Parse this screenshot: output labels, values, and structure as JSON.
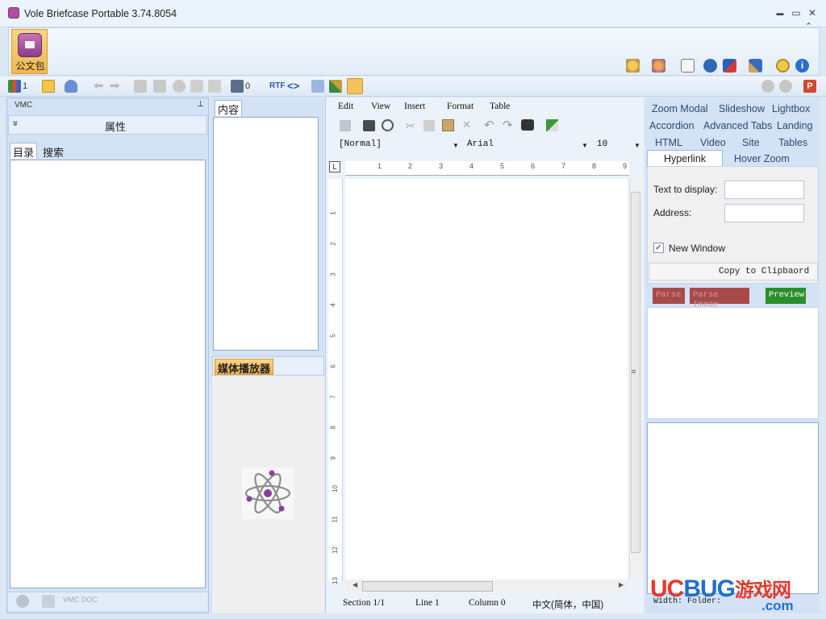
{
  "window": {
    "title": "Vole Briefcase Portable  3.74.8054",
    "minimize_glyph": "▬",
    "maximize_glyph": "▭",
    "close_glyph": "✕",
    "collapse_glyph": "⌃"
  },
  "ribbon": {
    "tile_label": "公文包",
    "icons": [
      "paint-icon",
      "magic-icon",
      "book-icon",
      "globe-icon",
      "flag-icon",
      "tools-icon",
      "medal-icon",
      "info-icon"
    ]
  },
  "toolbar": {
    "counter_1": "1",
    "counter_2": "0",
    "rtf_label": "RTF"
  },
  "left_panel": {
    "header": "VMC",
    "pin_glyph": "⊥",
    "collapse_glyph": "»",
    "properties_label": "属性",
    "tabs": [
      "目录",
      "搜索"
    ],
    "bottom_icons": [
      "VMC",
      "DOC"
    ]
  },
  "mid_panel": {
    "content_tab": "内容",
    "media_tab": "媒体播放器"
  },
  "editor": {
    "menu": [
      "Edit",
      "View",
      "Insert",
      "Format",
      "Table"
    ],
    "style_value": "[Normal]",
    "font_value": "Arial",
    "size_value": "10",
    "ruler_marks": [
      "1",
      "2",
      "3",
      "4",
      "5",
      "6",
      "7",
      "8",
      "9"
    ],
    "vruler_marks": [
      "1",
      "2",
      "3",
      "4",
      "5",
      "6",
      "7",
      "8",
      "9",
      "10",
      "11",
      "12",
      "13"
    ],
    "status": {
      "section": "Section 1/1",
      "line": "Line 1",
      "column": "Column 0",
      "language": "中文(简体，中国)"
    }
  },
  "right_panel": {
    "links_row1": [
      "Zoom Modal",
      "Slideshow",
      "Lightbox"
    ],
    "links_row2": [
      "Accordion",
      "Advanced Tabs",
      "Landing"
    ],
    "links_row3": [
      "HTML",
      "Video",
      "Site",
      "Tables"
    ],
    "tabs": [
      "Hyperlink",
      "Hover Zoom"
    ],
    "text_to_display_label": "Text to display:",
    "text_to_display_value": "",
    "address_label": "Address:",
    "address_value": "",
    "new_window_label": "New Window",
    "new_window_checked": true,
    "copy_button": "Copy to Clipbaord",
    "parse_button": "Parse",
    "parse_image_button": "Parse Image",
    "preview_button": "Preview",
    "width_folder": "Width: Folder:"
  },
  "watermark": {
    "brand_a": "UC",
    "brand_b": "BUG",
    "brand_c": "游戏网",
    "domain": ".com",
    "color_a": "#e8372c",
    "color_b": "#1f6fd1"
  },
  "colors": {
    "accent": "#f2b44a",
    "frame": "#d3e2f4",
    "link": "#2d4a73",
    "parse_red": "#a84a4a",
    "preview_green": "#2a8f2a"
  }
}
